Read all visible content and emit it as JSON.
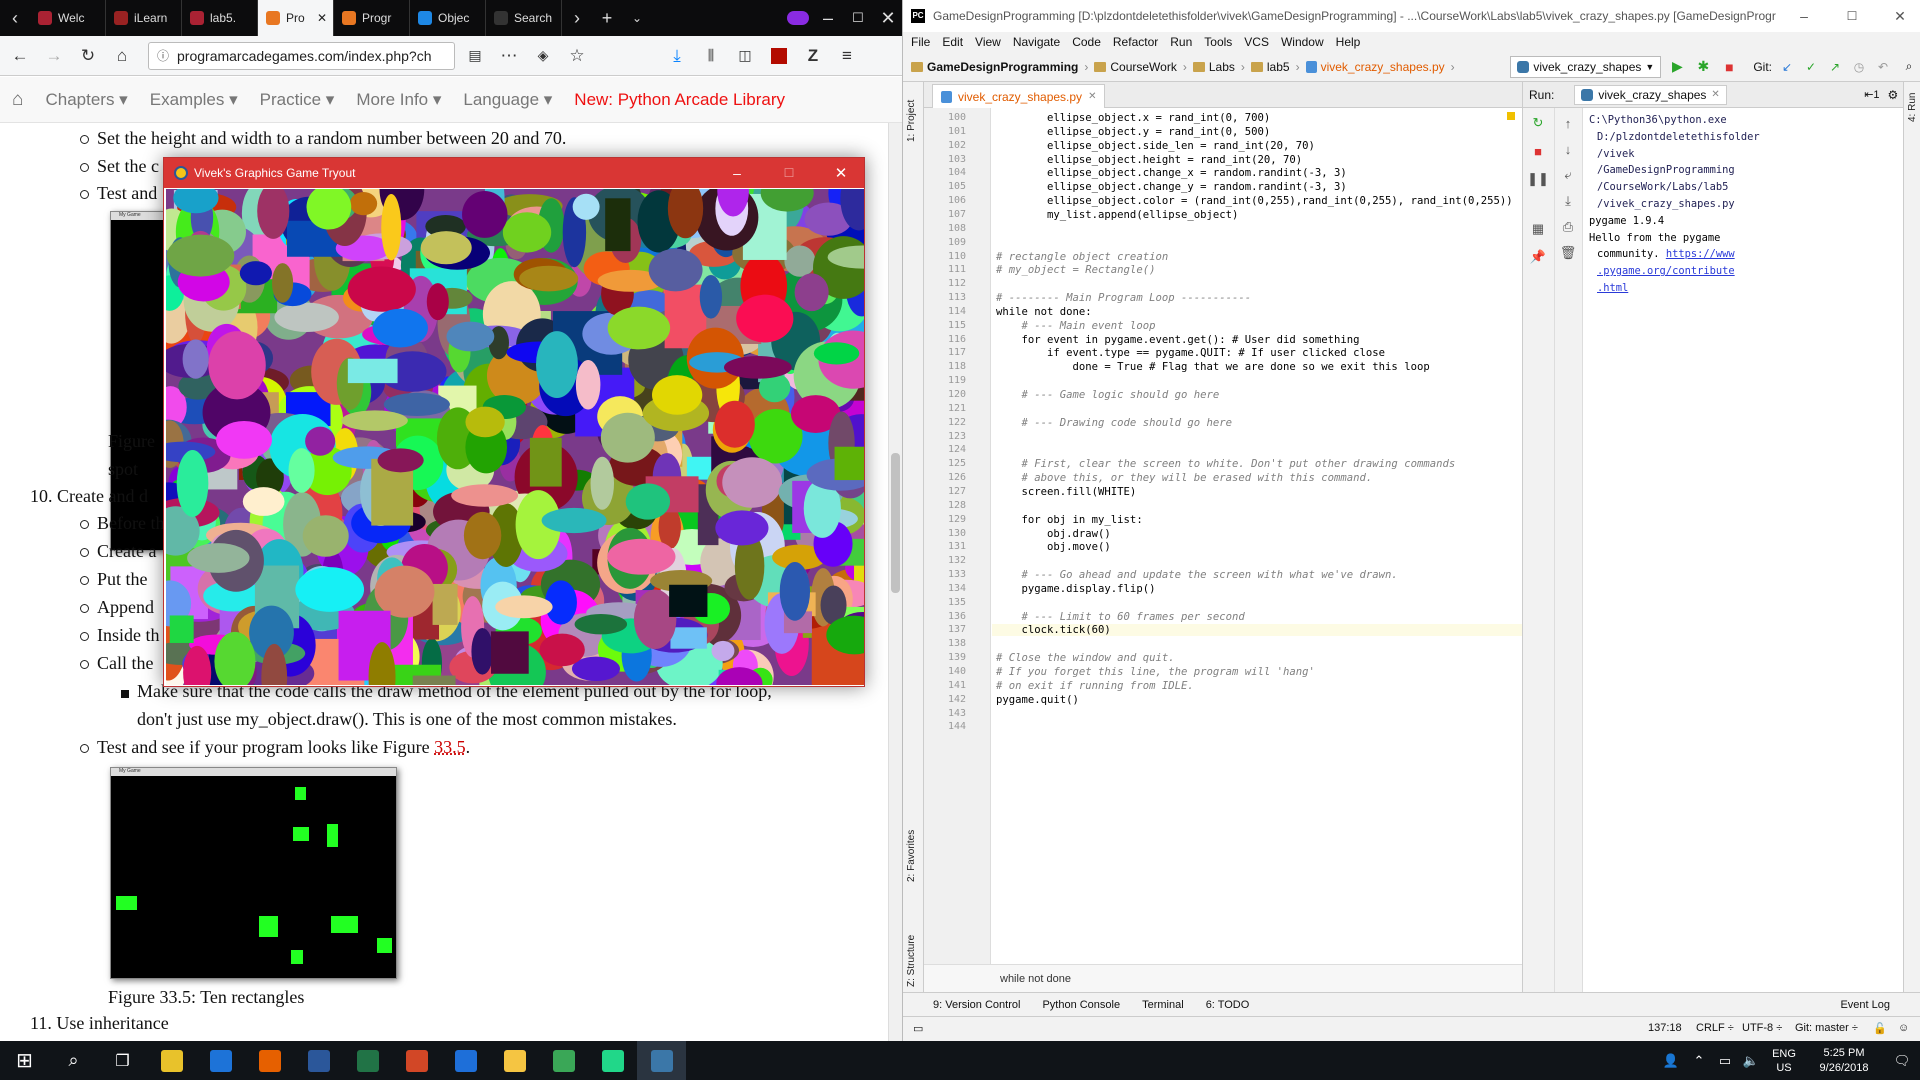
{
  "browser": {
    "tabs": [
      {
        "label": "Welc",
        "color": "#aa2233"
      },
      {
        "label": "iLearn",
        "color": "#992222"
      },
      {
        "label": "lab5.",
        "color": "#aa2233"
      },
      {
        "label": "Pro",
        "color": "#e87722",
        "active": true
      },
      {
        "label": "Progr",
        "color": "#e87722"
      },
      {
        "label": "Objec",
        "color": "#1e88e5"
      },
      {
        "label": "Search",
        "color": "#333333"
      }
    ],
    "url": "programarcadegames.com/index.php?ch",
    "sitenav": [
      "Chapters ▾",
      "Examples ▾",
      "Practice ▾",
      "More Info ▾",
      "Language ▾"
    ],
    "sitenav_new": "New: Python Arcade Library",
    "content": {
      "b1": "Set the height and width to a random number between 20 and 70.",
      "b2": "Set the c",
      "b3": "Test and",
      "fig_caption_a": "Figure",
      "fig_caption_b": "spot",
      "item10": "10. Create and d",
      "c1": "Before th",
      "c2": "Create a",
      "c3": "Put the",
      "c4": "Append",
      "c5": "Inside th",
      "c6": "Call the",
      "sub1": "Make sure that the code calls the draw method of the element pulled out by the for loop,",
      "sub2": "don't just use my_object.draw(). This is one of the most common mistakes.",
      "test_prefix": "Test and see if your program looks like Figure ",
      "test_link": "33.5",
      "test_suffix": ".",
      "fig_title": "My Game",
      "fig2_caption": "Figure 33.5: Ten rectangles",
      "item11": "11. Use inheritance"
    }
  },
  "game_window": {
    "title": "Vivek's Graphics Game Tryout"
  },
  "ide": {
    "title": "GameDesignProgramming [D:\\plzdontdeletethisfolder\\vivek\\GameDesignProgramming] - ...\\CourseWork\\Labs\\lab5\\vivek_crazy_shapes.py [GameDesignProgr...",
    "menu": [
      "File",
      "Edit",
      "View",
      "Navigate",
      "Code",
      "Refactor",
      "Run",
      "Tools",
      "VCS",
      "Window",
      "Help"
    ],
    "breadcrumbs": [
      "GameDesignProgramming",
      "CourseWork",
      "Labs",
      "lab5",
      "vivek_crazy_shapes.py"
    ],
    "run_config": "vivek_crazy_shapes",
    "git_label": "Git:",
    "editor_tab": "vivek_crazy_shapes.py",
    "left_tabs": [
      "1: Project",
      "2: Favorites",
      "Z: Structure"
    ],
    "right_tab": "4: Run",
    "code_lines": [
      {
        "n": "100",
        "t": "        ellipse_object.x = rand_int(0, 700)"
      },
      {
        "n": "101",
        "t": "        ellipse_object.y = rand_int(0, 500)"
      },
      {
        "n": "102",
        "t": "        ellipse_object.side_len = rand_int(20, 70)"
      },
      {
        "n": "103",
        "t": "        ellipse_object.height = rand_int(20, 70)"
      },
      {
        "n": "104",
        "t": "        ellipse_object.change_x = random.randint(-3, 3)"
      },
      {
        "n": "105",
        "t": "        ellipse_object.change_y = random.randint(-3, 3)"
      },
      {
        "n": "106",
        "t": "        ellipse_object.color = (rand_int(0,255),rand_int(0,255), rand_int(0,255))"
      },
      {
        "n": "107",
        "t": "        my_list.append(ellipse_object)"
      },
      {
        "n": "108",
        "t": ""
      },
      {
        "n": "109",
        "t": ""
      },
      {
        "n": "110",
        "t": "# rectangle object creation"
      },
      {
        "n": "111",
        "t": "# my_object = Rectangle()"
      },
      {
        "n": "112",
        "t": ""
      },
      {
        "n": "113",
        "t": "# -------- Main Program Loop -----------"
      },
      {
        "n": "114",
        "t": "while not done:"
      },
      {
        "n": "115",
        "t": "    # --- Main event loop"
      },
      {
        "n": "116",
        "t": "    for event in pygame.event.get(): # User did something"
      },
      {
        "n": "117",
        "t": "        if event.type == pygame.QUIT: # If user clicked close"
      },
      {
        "n": "118",
        "t": "            done = True # Flag that we are done so we exit this loop"
      },
      {
        "n": "119",
        "t": ""
      },
      {
        "n": "120",
        "t": "    # --- Game logic should go here"
      },
      {
        "n": "121",
        "t": ""
      },
      {
        "n": "122",
        "t": "    # --- Drawing code should go here"
      },
      {
        "n": "123",
        "t": ""
      },
      {
        "n": "124",
        "t": ""
      },
      {
        "n": "125",
        "t": "    # First, clear the screen to white. Don't put other drawing commands"
      },
      {
        "n": "126",
        "t": "    # above this, or they will be erased with this command."
      },
      {
        "n": "127",
        "t": "    screen.fill(WHITE)"
      },
      {
        "n": "128",
        "t": ""
      },
      {
        "n": "129",
        "t": "    for obj in my_list:"
      },
      {
        "n": "130",
        "t": "        obj.draw()"
      },
      {
        "n": "131",
        "t": "        obj.move()"
      },
      {
        "n": "132",
        "t": ""
      },
      {
        "n": "133",
        "t": "    # --- Go ahead and update the screen with what we've drawn."
      },
      {
        "n": "134",
        "t": "    pygame.display.flip()"
      },
      {
        "n": "135",
        "t": ""
      },
      {
        "n": "136",
        "t": "    # --- Limit to 60 frames per second"
      },
      {
        "n": "137",
        "t": "    clock.tick(60)"
      },
      {
        "n": "138",
        "t": ""
      },
      {
        "n": "139",
        "t": "# Close the window and quit."
      },
      {
        "n": "140",
        "t": "# If you forget this line, the program will 'hang'"
      },
      {
        "n": "141",
        "t": "# on exit if running from IDLE."
      },
      {
        "n": "142",
        "t": "pygame.quit()"
      },
      {
        "n": "143",
        "t": ""
      },
      {
        "n": "144",
        "t": ""
      }
    ],
    "editor_footer": "while not done",
    "run_label": "Run:",
    "run_tab": "vivek_crazy_shapes",
    "console": {
      "l1": "C:\\Python36\\python.exe",
      "l2": "D:/plzdontdeletethisfolder",
      "l3": "/vivek",
      "l4": "/GameDesignProgramming",
      "l5": "/CourseWork/Labs/lab5",
      "l6": "/vivek_crazy_shapes.py",
      "l7": "pygame 1.9.4",
      "l8": "Hello from the pygame",
      "l9": "community. ",
      "l9_link": "https://www",
      "l10": ".pygame.org/contribute",
      "l11": ".html"
    },
    "bottom_tools": [
      "9: Version Control",
      "Python Console",
      "Terminal",
      "6: TODO"
    ],
    "event_log": "Event Log",
    "status": {
      "position": "137:18",
      "line_sep": "CRLF ÷",
      "encoding": "UTF-8 ÷",
      "git": "Git: master ÷"
    }
  },
  "taskbar": {
    "apps": [
      {
        "name": "chrome",
        "color": "#e8c22b"
      },
      {
        "name": "edge",
        "color": "#1d73d8"
      },
      {
        "name": "firefox",
        "color": "#e66000"
      },
      {
        "name": "word",
        "color": "#2b579a"
      },
      {
        "name": "excel",
        "color": "#217346"
      },
      {
        "name": "powerpoint",
        "color": "#d24726"
      },
      {
        "name": "app-blue",
        "color": "#1e6fd9"
      },
      {
        "name": "file-explorer",
        "color": "#f5c542"
      },
      {
        "name": "app-diamond",
        "color": "#3aa757"
      },
      {
        "name": "pycharm",
        "color": "#21d789"
      },
      {
        "name": "python",
        "color": "#3b77a8"
      }
    ],
    "lang": "ENG",
    "region": "US",
    "time": "5:25 PM",
    "date": "9/26/2018"
  }
}
